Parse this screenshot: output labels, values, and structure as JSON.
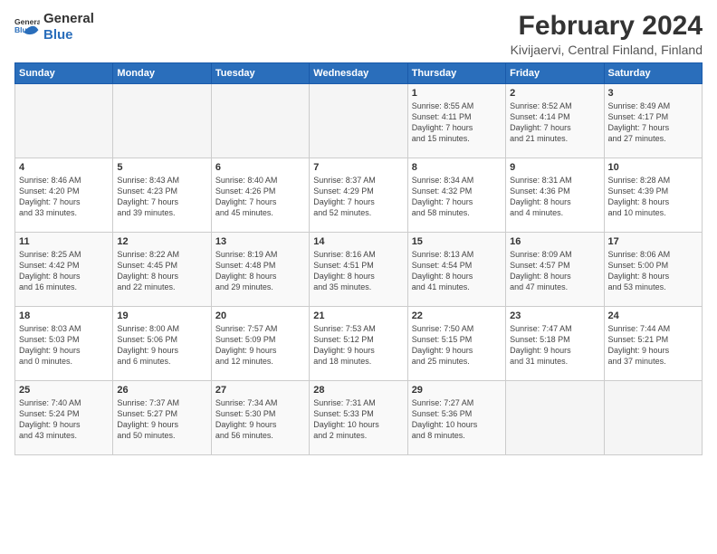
{
  "header": {
    "logo_general": "General",
    "logo_blue": "Blue",
    "title": "February 2024",
    "subtitle": "Kivijaervi, Central Finland, Finland"
  },
  "weekdays": [
    "Sunday",
    "Monday",
    "Tuesday",
    "Wednesday",
    "Thursday",
    "Friday",
    "Saturday"
  ],
  "weeks": [
    [
      {
        "day": "",
        "info": ""
      },
      {
        "day": "",
        "info": ""
      },
      {
        "day": "",
        "info": ""
      },
      {
        "day": "",
        "info": ""
      },
      {
        "day": "1",
        "info": "Sunrise: 8:55 AM\nSunset: 4:11 PM\nDaylight: 7 hours\nand 15 minutes."
      },
      {
        "day": "2",
        "info": "Sunrise: 8:52 AM\nSunset: 4:14 PM\nDaylight: 7 hours\nand 21 minutes."
      },
      {
        "day": "3",
        "info": "Sunrise: 8:49 AM\nSunset: 4:17 PM\nDaylight: 7 hours\nand 27 minutes."
      }
    ],
    [
      {
        "day": "4",
        "info": "Sunrise: 8:46 AM\nSunset: 4:20 PM\nDaylight: 7 hours\nand 33 minutes."
      },
      {
        "day": "5",
        "info": "Sunrise: 8:43 AM\nSunset: 4:23 PM\nDaylight: 7 hours\nand 39 minutes."
      },
      {
        "day": "6",
        "info": "Sunrise: 8:40 AM\nSunset: 4:26 PM\nDaylight: 7 hours\nand 45 minutes."
      },
      {
        "day": "7",
        "info": "Sunrise: 8:37 AM\nSunset: 4:29 PM\nDaylight: 7 hours\nand 52 minutes."
      },
      {
        "day": "8",
        "info": "Sunrise: 8:34 AM\nSunset: 4:32 PM\nDaylight: 7 hours\nand 58 minutes."
      },
      {
        "day": "9",
        "info": "Sunrise: 8:31 AM\nSunset: 4:36 PM\nDaylight: 8 hours\nand 4 minutes."
      },
      {
        "day": "10",
        "info": "Sunrise: 8:28 AM\nSunset: 4:39 PM\nDaylight: 8 hours\nand 10 minutes."
      }
    ],
    [
      {
        "day": "11",
        "info": "Sunrise: 8:25 AM\nSunset: 4:42 PM\nDaylight: 8 hours\nand 16 minutes."
      },
      {
        "day": "12",
        "info": "Sunrise: 8:22 AM\nSunset: 4:45 PM\nDaylight: 8 hours\nand 22 minutes."
      },
      {
        "day": "13",
        "info": "Sunrise: 8:19 AM\nSunset: 4:48 PM\nDaylight: 8 hours\nand 29 minutes."
      },
      {
        "day": "14",
        "info": "Sunrise: 8:16 AM\nSunset: 4:51 PM\nDaylight: 8 hours\nand 35 minutes."
      },
      {
        "day": "15",
        "info": "Sunrise: 8:13 AM\nSunset: 4:54 PM\nDaylight: 8 hours\nand 41 minutes."
      },
      {
        "day": "16",
        "info": "Sunrise: 8:09 AM\nSunset: 4:57 PM\nDaylight: 8 hours\nand 47 minutes."
      },
      {
        "day": "17",
        "info": "Sunrise: 8:06 AM\nSunset: 5:00 PM\nDaylight: 8 hours\nand 53 minutes."
      }
    ],
    [
      {
        "day": "18",
        "info": "Sunrise: 8:03 AM\nSunset: 5:03 PM\nDaylight: 9 hours\nand 0 minutes."
      },
      {
        "day": "19",
        "info": "Sunrise: 8:00 AM\nSunset: 5:06 PM\nDaylight: 9 hours\nand 6 minutes."
      },
      {
        "day": "20",
        "info": "Sunrise: 7:57 AM\nSunset: 5:09 PM\nDaylight: 9 hours\nand 12 minutes."
      },
      {
        "day": "21",
        "info": "Sunrise: 7:53 AM\nSunset: 5:12 PM\nDaylight: 9 hours\nand 18 minutes."
      },
      {
        "day": "22",
        "info": "Sunrise: 7:50 AM\nSunset: 5:15 PM\nDaylight: 9 hours\nand 25 minutes."
      },
      {
        "day": "23",
        "info": "Sunrise: 7:47 AM\nSunset: 5:18 PM\nDaylight: 9 hours\nand 31 minutes."
      },
      {
        "day": "24",
        "info": "Sunrise: 7:44 AM\nSunset: 5:21 PM\nDaylight: 9 hours\nand 37 minutes."
      }
    ],
    [
      {
        "day": "25",
        "info": "Sunrise: 7:40 AM\nSunset: 5:24 PM\nDaylight: 9 hours\nand 43 minutes."
      },
      {
        "day": "26",
        "info": "Sunrise: 7:37 AM\nSunset: 5:27 PM\nDaylight: 9 hours\nand 50 minutes."
      },
      {
        "day": "27",
        "info": "Sunrise: 7:34 AM\nSunset: 5:30 PM\nDaylight: 9 hours\nand 56 minutes."
      },
      {
        "day": "28",
        "info": "Sunrise: 7:31 AM\nSunset: 5:33 PM\nDaylight: 10 hours\nand 2 minutes."
      },
      {
        "day": "29",
        "info": "Sunrise: 7:27 AM\nSunset: 5:36 PM\nDaylight: 10 hours\nand 8 minutes."
      },
      {
        "day": "",
        "info": ""
      },
      {
        "day": "",
        "info": ""
      }
    ]
  ]
}
